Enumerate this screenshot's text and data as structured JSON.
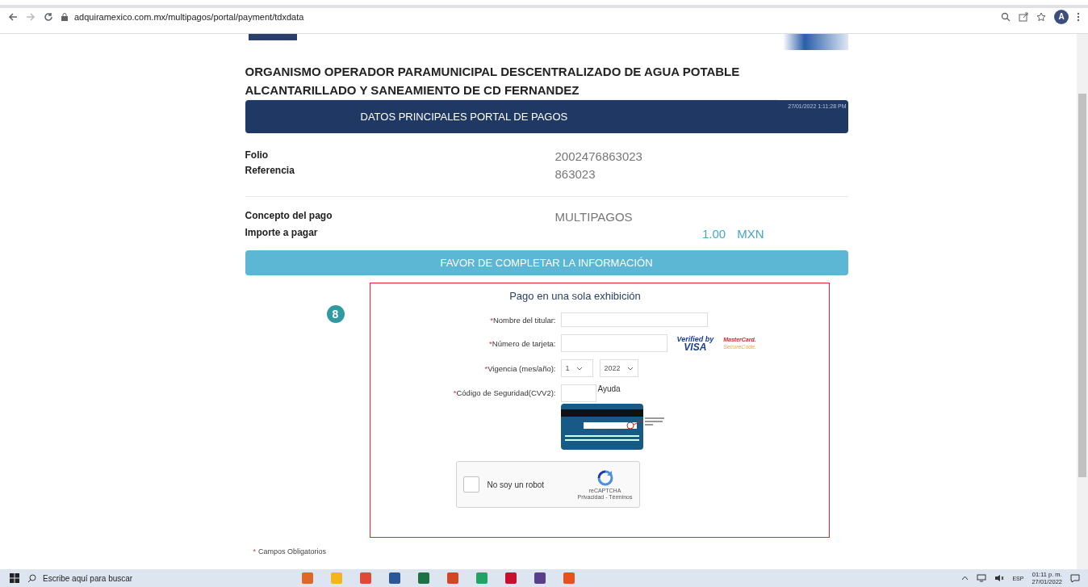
{
  "browser": {
    "url": "adquiramexico.com.mx/multipagos/portal/payment/tdxdata",
    "profile_initial": "A"
  },
  "page": {
    "organization": [
      "ORGANISMO OPERADOR PARAMUNICIPAL DESCENTRALIZADO DE AGUA POTABLE",
      "ALCANTARILLADO Y SANEAMIENTO DE CD FERNANDEZ"
    ],
    "header": {
      "title": "DATOS PRINCIPALES PORTAL DE PAGOS",
      "timestamp": "27/01/2022 1:11:28 PM"
    },
    "details": [
      {
        "label": "Folio",
        "value": "2002476863023"
      },
      {
        "label": "Referencia",
        "value": "863023"
      }
    ],
    "concept": {
      "label": "Concepto del pago",
      "value": "MULTIPAGOS"
    },
    "amount": {
      "label": "Importe a pagar",
      "value": "1.00",
      "currency": "MXN"
    },
    "notice": "FAVOR DE COMPLETAR LA INFORMACIÓN",
    "step_badge": "8",
    "form": {
      "title": "Pago en una sola exhibición",
      "fields": [
        {
          "kind": "text",
          "required_mark": "*",
          "label": "Nombre del titular:"
        },
        {
          "kind": "card",
          "required_mark": "*",
          "label": "Número de tarjeta:",
          "visa": [
            "Verified by",
            "VISA"
          ],
          "mastercard": [
            "MasterCard.",
            "SecureCode."
          ]
        },
        {
          "kind": "expiry",
          "required_mark": "*",
          "label": "Vigencia (mes/año):",
          "month": "1",
          "year": "2022"
        },
        {
          "kind": "cvv",
          "required_mark": "*",
          "label": "Código de Seguridad(CVV2):",
          "help": "Ayuda"
        }
      ],
      "captcha": {
        "label": "No soy un robot",
        "checked": false,
        "brand": "reCAPTCHA",
        "links": "Privacidad - Términos"
      }
    },
    "footnote": {
      "mark": "*",
      "text": "Campos Obligatorios"
    }
  },
  "taskbar": {
    "search_placeholder": "Escribe aquí para buscar",
    "apps": [
      {
        "color": "#e0662a"
      },
      {
        "color": "#f2b51c"
      },
      {
        "color": "#de4a37"
      },
      {
        "color": "#2b5797"
      },
      {
        "color": "#1e7145"
      },
      {
        "color": "#d24726"
      },
      {
        "color": "#21a366"
      },
      {
        "color": "#c8102e"
      },
      {
        "color": "#5a3e8a"
      },
      {
        "color": "#e8501e"
      }
    ],
    "language": "ESP",
    "time": "01:11 p. m.",
    "date": "27/01/2022"
  }
}
